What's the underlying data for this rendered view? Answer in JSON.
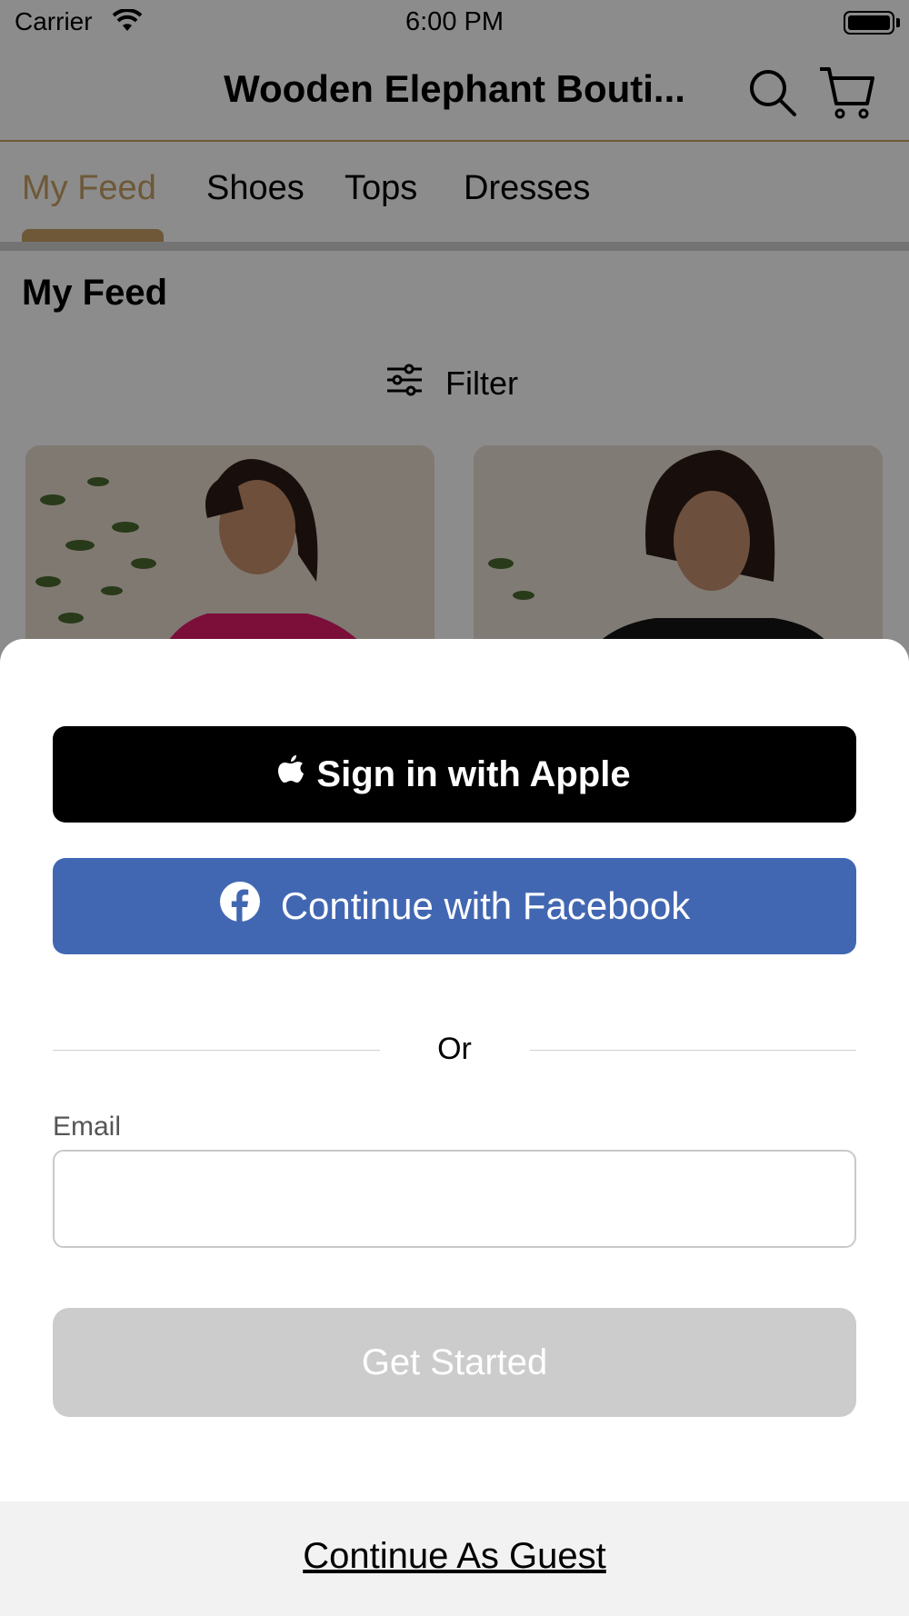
{
  "status_bar": {
    "carrier": "Carrier",
    "time": "6:00 PM"
  },
  "header": {
    "title": "Wooden Elephant Bouti..."
  },
  "tabs": [
    {
      "label": "My Feed",
      "active": true
    },
    {
      "label": "Shoes"
    },
    {
      "label": "Tops"
    },
    {
      "label": "Dresses"
    }
  ],
  "page": {
    "title": "My Feed",
    "filter_label": "Filter"
  },
  "products": [
    {
      "image": "woman-pink-ruffle-top-photo"
    },
    {
      "image": "woman-black-ruffle-top-photo"
    }
  ],
  "sign_in_sheet": {
    "apple_label": "Sign in with Apple",
    "facebook_label": "Continue with Facebook",
    "divider_text": "Or",
    "email_label": "Email",
    "email_value": "",
    "email_placeholder": "",
    "get_started_label": "Get Started",
    "guest_label": "Continue As Guest"
  },
  "colors": {
    "accent": "#c8a064",
    "facebook": "#4267b2",
    "apple_button": "#000000",
    "disabled_button": "#cccccc",
    "guest_bar": "#f2f2f2"
  }
}
